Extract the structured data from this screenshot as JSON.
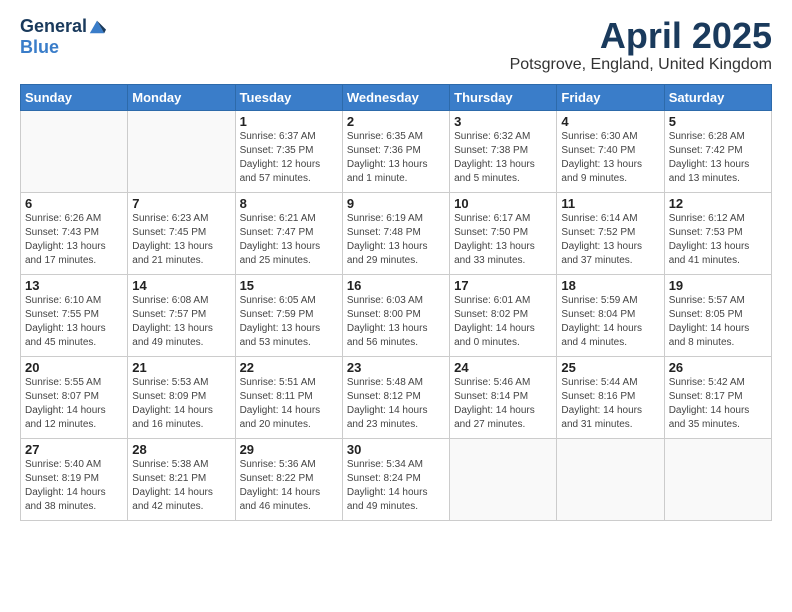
{
  "logo": {
    "general": "General",
    "blue": "Blue"
  },
  "title": "April 2025",
  "location": "Potsgrove, England, United Kingdom",
  "days_of_week": [
    "Sunday",
    "Monday",
    "Tuesday",
    "Wednesday",
    "Thursday",
    "Friday",
    "Saturday"
  ],
  "weeks": [
    [
      {
        "day": "",
        "sunrise": "",
        "sunset": "",
        "daylight": ""
      },
      {
        "day": "",
        "sunrise": "",
        "sunset": "",
        "daylight": ""
      },
      {
        "day": "1",
        "sunrise": "Sunrise: 6:37 AM",
        "sunset": "Sunset: 7:35 PM",
        "daylight": "Daylight: 12 hours and 57 minutes."
      },
      {
        "day": "2",
        "sunrise": "Sunrise: 6:35 AM",
        "sunset": "Sunset: 7:36 PM",
        "daylight": "Daylight: 13 hours and 1 minute."
      },
      {
        "day": "3",
        "sunrise": "Sunrise: 6:32 AM",
        "sunset": "Sunset: 7:38 PM",
        "daylight": "Daylight: 13 hours and 5 minutes."
      },
      {
        "day": "4",
        "sunrise": "Sunrise: 6:30 AM",
        "sunset": "Sunset: 7:40 PM",
        "daylight": "Daylight: 13 hours and 9 minutes."
      },
      {
        "day": "5",
        "sunrise": "Sunrise: 6:28 AM",
        "sunset": "Sunset: 7:42 PM",
        "daylight": "Daylight: 13 hours and 13 minutes."
      }
    ],
    [
      {
        "day": "6",
        "sunrise": "Sunrise: 6:26 AM",
        "sunset": "Sunset: 7:43 PM",
        "daylight": "Daylight: 13 hours and 17 minutes."
      },
      {
        "day": "7",
        "sunrise": "Sunrise: 6:23 AM",
        "sunset": "Sunset: 7:45 PM",
        "daylight": "Daylight: 13 hours and 21 minutes."
      },
      {
        "day": "8",
        "sunrise": "Sunrise: 6:21 AM",
        "sunset": "Sunset: 7:47 PM",
        "daylight": "Daylight: 13 hours and 25 minutes."
      },
      {
        "day": "9",
        "sunrise": "Sunrise: 6:19 AM",
        "sunset": "Sunset: 7:48 PM",
        "daylight": "Daylight: 13 hours and 29 minutes."
      },
      {
        "day": "10",
        "sunrise": "Sunrise: 6:17 AM",
        "sunset": "Sunset: 7:50 PM",
        "daylight": "Daylight: 13 hours and 33 minutes."
      },
      {
        "day": "11",
        "sunrise": "Sunrise: 6:14 AM",
        "sunset": "Sunset: 7:52 PM",
        "daylight": "Daylight: 13 hours and 37 minutes."
      },
      {
        "day": "12",
        "sunrise": "Sunrise: 6:12 AM",
        "sunset": "Sunset: 7:53 PM",
        "daylight": "Daylight: 13 hours and 41 minutes."
      }
    ],
    [
      {
        "day": "13",
        "sunrise": "Sunrise: 6:10 AM",
        "sunset": "Sunset: 7:55 PM",
        "daylight": "Daylight: 13 hours and 45 minutes."
      },
      {
        "day": "14",
        "sunrise": "Sunrise: 6:08 AM",
        "sunset": "Sunset: 7:57 PM",
        "daylight": "Daylight: 13 hours and 49 minutes."
      },
      {
        "day": "15",
        "sunrise": "Sunrise: 6:05 AM",
        "sunset": "Sunset: 7:59 PM",
        "daylight": "Daylight: 13 hours and 53 minutes."
      },
      {
        "day": "16",
        "sunrise": "Sunrise: 6:03 AM",
        "sunset": "Sunset: 8:00 PM",
        "daylight": "Daylight: 13 hours and 56 minutes."
      },
      {
        "day": "17",
        "sunrise": "Sunrise: 6:01 AM",
        "sunset": "Sunset: 8:02 PM",
        "daylight": "Daylight: 14 hours and 0 minutes."
      },
      {
        "day": "18",
        "sunrise": "Sunrise: 5:59 AM",
        "sunset": "Sunset: 8:04 PM",
        "daylight": "Daylight: 14 hours and 4 minutes."
      },
      {
        "day": "19",
        "sunrise": "Sunrise: 5:57 AM",
        "sunset": "Sunset: 8:05 PM",
        "daylight": "Daylight: 14 hours and 8 minutes."
      }
    ],
    [
      {
        "day": "20",
        "sunrise": "Sunrise: 5:55 AM",
        "sunset": "Sunset: 8:07 PM",
        "daylight": "Daylight: 14 hours and 12 minutes."
      },
      {
        "day": "21",
        "sunrise": "Sunrise: 5:53 AM",
        "sunset": "Sunset: 8:09 PM",
        "daylight": "Daylight: 14 hours and 16 minutes."
      },
      {
        "day": "22",
        "sunrise": "Sunrise: 5:51 AM",
        "sunset": "Sunset: 8:11 PM",
        "daylight": "Daylight: 14 hours and 20 minutes."
      },
      {
        "day": "23",
        "sunrise": "Sunrise: 5:48 AM",
        "sunset": "Sunset: 8:12 PM",
        "daylight": "Daylight: 14 hours and 23 minutes."
      },
      {
        "day": "24",
        "sunrise": "Sunrise: 5:46 AM",
        "sunset": "Sunset: 8:14 PM",
        "daylight": "Daylight: 14 hours and 27 minutes."
      },
      {
        "day": "25",
        "sunrise": "Sunrise: 5:44 AM",
        "sunset": "Sunset: 8:16 PM",
        "daylight": "Daylight: 14 hours and 31 minutes."
      },
      {
        "day": "26",
        "sunrise": "Sunrise: 5:42 AM",
        "sunset": "Sunset: 8:17 PM",
        "daylight": "Daylight: 14 hours and 35 minutes."
      }
    ],
    [
      {
        "day": "27",
        "sunrise": "Sunrise: 5:40 AM",
        "sunset": "Sunset: 8:19 PM",
        "daylight": "Daylight: 14 hours and 38 minutes."
      },
      {
        "day": "28",
        "sunrise": "Sunrise: 5:38 AM",
        "sunset": "Sunset: 8:21 PM",
        "daylight": "Daylight: 14 hours and 42 minutes."
      },
      {
        "day": "29",
        "sunrise": "Sunrise: 5:36 AM",
        "sunset": "Sunset: 8:22 PM",
        "daylight": "Daylight: 14 hours and 46 minutes."
      },
      {
        "day": "30",
        "sunrise": "Sunrise: 5:34 AM",
        "sunset": "Sunset: 8:24 PM",
        "daylight": "Daylight: 14 hours and 49 minutes."
      },
      {
        "day": "",
        "sunrise": "",
        "sunset": "",
        "daylight": ""
      },
      {
        "day": "",
        "sunrise": "",
        "sunset": "",
        "daylight": ""
      },
      {
        "day": "",
        "sunrise": "",
        "sunset": "",
        "daylight": ""
      }
    ]
  ]
}
